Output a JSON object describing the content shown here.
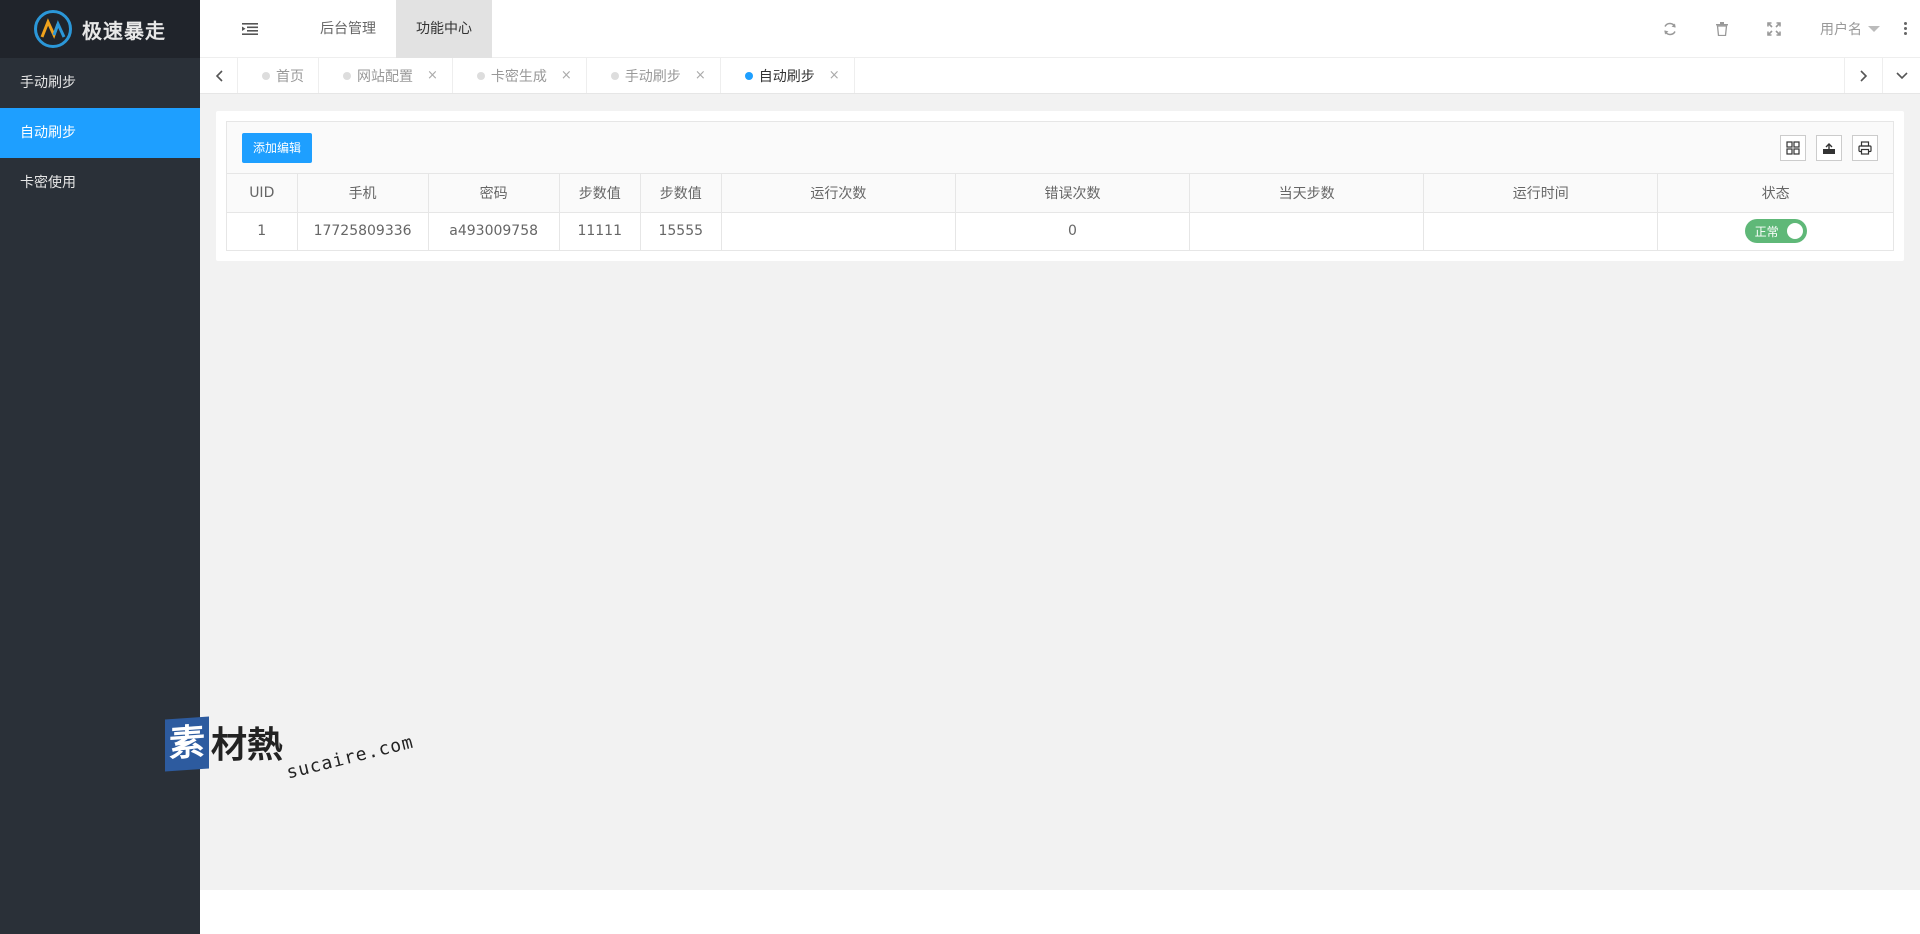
{
  "brand": {
    "name": "极速暴走",
    "accent": "#1e9fff",
    "sidebar_bg": "#2a3038"
  },
  "sidebar": {
    "items": [
      {
        "label": "手动刷步",
        "active": false
      },
      {
        "label": "自动刷步",
        "active": true
      },
      {
        "label": "卡密使用",
        "active": false
      }
    ]
  },
  "header": {
    "menu_icon": "menu-indent-icon",
    "nav": [
      {
        "label": "后台管理",
        "active": false
      },
      {
        "label": "功能中心",
        "active": true
      }
    ],
    "right_icons": [
      "refresh-icon",
      "trash-icon",
      "fullscreen-icon"
    ],
    "user_label": "用户名",
    "more_icon": "more-vertical-icon"
  },
  "tabs": {
    "items": [
      {
        "label": "首页",
        "closable": false,
        "active": false
      },
      {
        "label": "网站配置",
        "closable": true,
        "active": false
      },
      {
        "label": "卡密生成",
        "closable": true,
        "active": false
      },
      {
        "label": "手动刷步",
        "closable": true,
        "active": false
      },
      {
        "label": "自动刷步",
        "closable": true,
        "active": true
      }
    ],
    "close_glyph": "×"
  },
  "toolbar": {
    "add_label": "添加编辑",
    "tool_icons": [
      "columns-icon",
      "export-icon",
      "print-icon"
    ]
  },
  "table": {
    "headers": [
      "UID",
      "手机",
      "密码",
      "步数值",
      "步数值",
      "运行次数",
      "错误次数",
      "当天步数",
      "运行时间",
      "状态"
    ],
    "rows": [
      {
        "uid": "1",
        "phone": "17725809336",
        "password": "a493009758",
        "steps_a": "11111",
        "steps_b": "15555",
        "run_count": "",
        "error_count": "0",
        "today_steps": "",
        "run_time": "",
        "status": "正常"
      }
    ]
  },
  "watermark": {
    "badge": "素",
    "cn": "材熱",
    "en": "sucaire.com"
  }
}
